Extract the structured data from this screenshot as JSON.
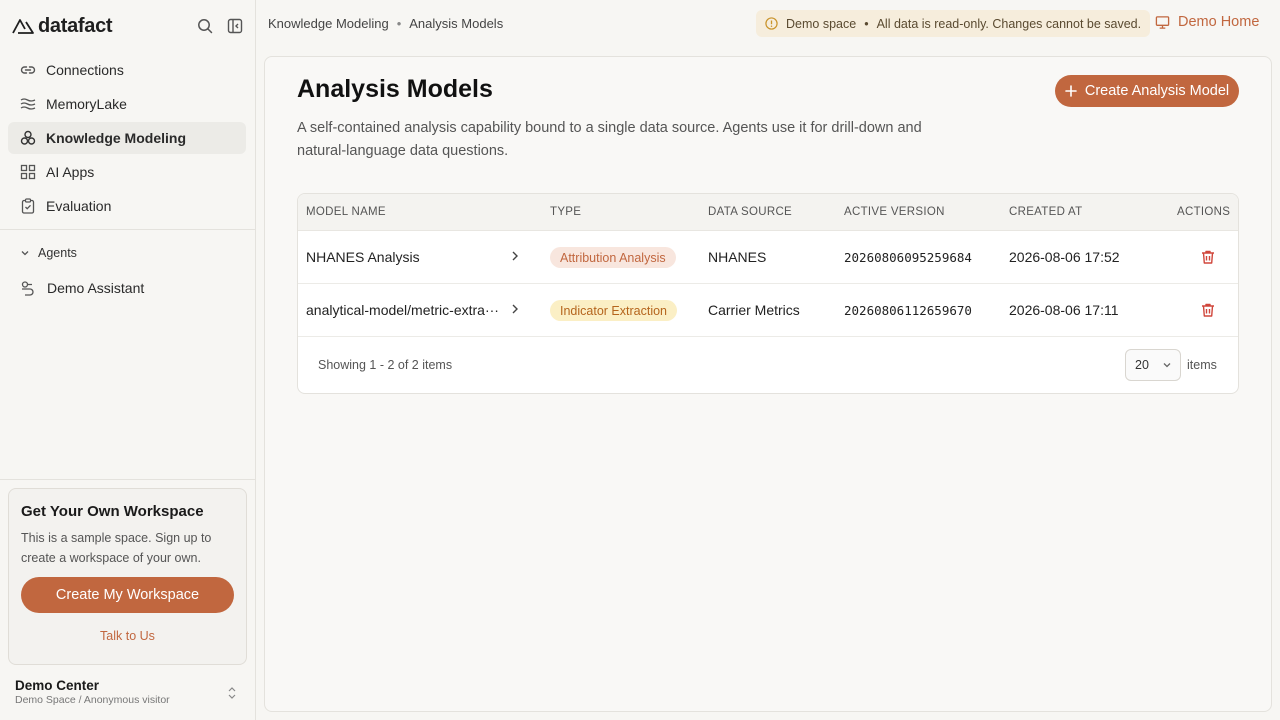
{
  "app": {
    "logo_text": "datafact"
  },
  "sidebar": {
    "items": [
      {
        "label": "Connections",
        "icon": "link-icon"
      },
      {
        "label": "MemoryLake",
        "icon": "waves-icon"
      },
      {
        "label": "Knowledge Modeling",
        "icon": "cubes-icon",
        "active": true
      },
      {
        "label": "AI Apps",
        "icon": "grid-icon"
      },
      {
        "label": "Evaluation",
        "icon": "clipboard-check-icon"
      }
    ],
    "agents_label": "Agents",
    "agents": [
      {
        "label": "Demo Assistant",
        "icon": "bot-icon"
      }
    ],
    "promo": {
      "title": "Get Your Own Workspace",
      "text": "This is a sample space. Sign up to create a workspace of your own.",
      "button": "Create My Workspace",
      "link": "Talk to Us"
    },
    "account": {
      "name": "Demo Center",
      "sub": "Demo Space / Anonymous visitor"
    }
  },
  "topbar": {
    "breadcrumb": [
      "Knowledge Modeling",
      "Analysis Models"
    ],
    "banner_label": "Demo space",
    "banner_text": "All data is read-only. Changes cannot be saved.",
    "demo_home": "Demo Home"
  },
  "main": {
    "title": "Analysis Models",
    "description": "A self-contained analysis capability bound to a single data source. Agents use it for drill-down and natural-language data questions.",
    "create_button": "Create Analysis Model",
    "columns": [
      "MODEL NAME",
      "TYPE",
      "DATA SOURCE",
      "ACTIVE VERSION",
      "CREATED AT",
      "ACTIONS"
    ],
    "rows": [
      {
        "name": "NHANES Analysis",
        "type": "Attribution Analysis",
        "type_style": "attr",
        "source": "NHANES",
        "version": "20260806095259684",
        "created": "2026-08-06 17:52"
      },
      {
        "name": "analytical-model/metric-extra···",
        "type": "Indicator Extraction",
        "type_style": "ind",
        "source": "Carrier Metrics",
        "version": "20260806112659670",
        "created": "2026-08-06 17:11"
      }
    ],
    "showing": "Showing 1 - 2 of 2 items",
    "page_size": "20",
    "items_label": "items"
  },
  "colors": {
    "accent": "#c1673f",
    "danger": "#d0463b",
    "banner_bg": "#f6eddc"
  }
}
